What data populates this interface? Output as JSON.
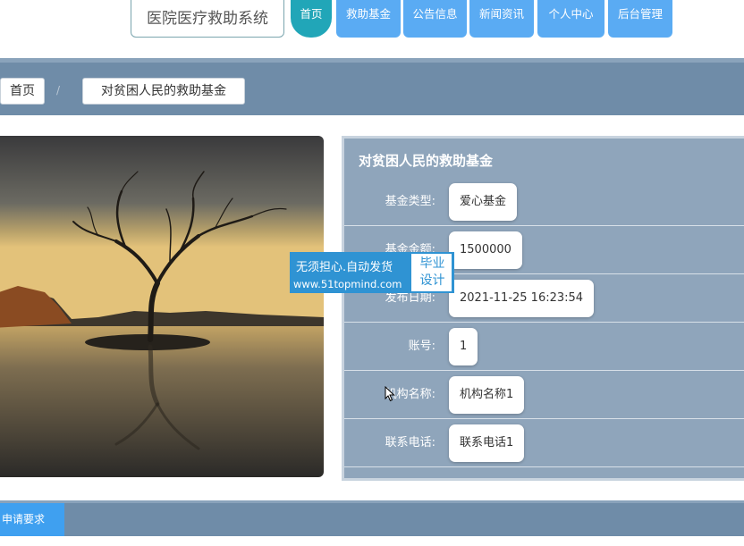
{
  "site": {
    "title": "医院医疗救助系统"
  },
  "nav": {
    "items": [
      {
        "label": "首页",
        "active": true
      },
      {
        "label": "救助基金"
      },
      {
        "label": "公告信息"
      },
      {
        "label": "新闻资讯"
      },
      {
        "label": "个人中心"
      },
      {
        "label": "后台管理"
      }
    ]
  },
  "breadcrumb": {
    "home": "首页",
    "separator": "/",
    "current": "对贫困人民的救助基金"
  },
  "detail": {
    "title": "对贫困人民的救助基金",
    "fields": [
      {
        "label": "基金类型:",
        "value": "爱心基金"
      },
      {
        "label": "基金金额:",
        "value": "1500000"
      },
      {
        "label": "发布日期:",
        "value": "2021-11-25 16:23:54"
      },
      {
        "label": "账号:",
        "value": "1"
      },
      {
        "label": "机构名称:",
        "value": "机构名称1"
      },
      {
        "label": "联系电话:",
        "value": "联系电话1"
      }
    ]
  },
  "watermark": {
    "line1": "无须担心.自动发货",
    "line2": "www.51topmind.com",
    "box_top": "毕业",
    "box_bottom": "设计"
  },
  "bottom_tabs": [
    {
      "label": "申请要求"
    }
  ],
  "colors": {
    "nav": "#5aabf3",
    "nav_active": "#21a6b8",
    "bar": "#6f8ca8",
    "panel": "#8fa5bb"
  }
}
